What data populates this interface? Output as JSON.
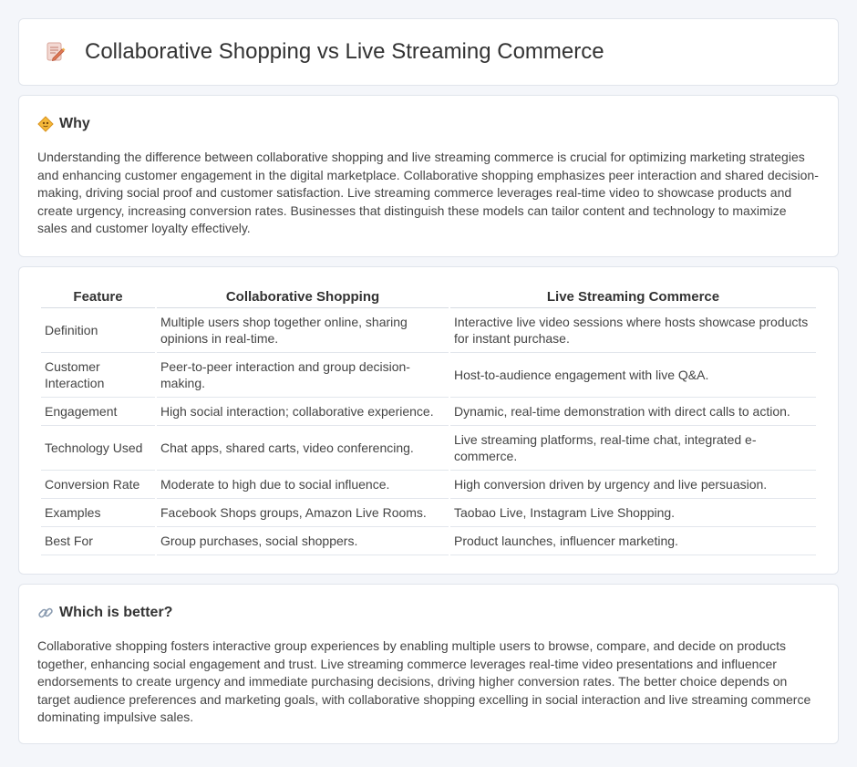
{
  "header": {
    "title": "Collaborative Shopping vs Live Streaming Commerce",
    "icon": "document-pencil-icon"
  },
  "why": {
    "title": "Why",
    "icon": "diamond-sign-icon",
    "text": "Understanding the difference between collaborative shopping and live streaming commerce is crucial for optimizing marketing strategies and enhancing customer engagement in the digital marketplace. Collaborative shopping emphasizes peer interaction and shared decision-making, driving social proof and customer satisfaction. Live streaming commerce leverages real-time video to showcase products and create urgency, increasing conversion rates. Businesses that distinguish these models can tailor content and technology to maximize sales and customer loyalty effectively."
  },
  "table": {
    "headers": [
      "Feature",
      "Collaborative Shopping",
      "Live Streaming Commerce"
    ],
    "rows": [
      [
        "Definition",
        "Multiple users shop together online, sharing opinions in real-time.",
        "Interactive live video sessions where hosts showcase products for instant purchase."
      ],
      [
        "Customer Interaction",
        "Peer-to-peer interaction and group decision-making.",
        "Host-to-audience engagement with live Q&A."
      ],
      [
        "Engagement",
        "High social interaction; collaborative experience.",
        "Dynamic, real-time demonstration with direct calls to action."
      ],
      [
        "Technology Used",
        "Chat apps, shared carts, video conferencing.",
        "Live streaming platforms, real-time chat, integrated e-commerce."
      ],
      [
        "Conversion Rate",
        "Moderate to high due to social influence.",
        "High conversion driven by urgency and live persuasion."
      ],
      [
        "Examples",
        "Facebook Shops groups, Amazon Live Rooms.",
        "Taobao Live, Instagram Live Shopping."
      ],
      [
        "Best For",
        "Group purchases, social shoppers.",
        "Product launches, influencer marketing."
      ]
    ]
  },
  "which": {
    "title": "Which is better?",
    "icon": "link-icon",
    "text": "Collaborative shopping fosters interactive group experiences by enabling multiple users to browse, compare, and decide on products together, enhancing social engagement and trust. Live streaming commerce leverages real-time video presentations and influencer endorsements to create urgency and immediate purchasing decisions, driving higher conversion rates. The better choice depends on target audience preferences and marketing goals, with collaborative shopping excelling in social interaction and live streaming commerce dominating impulsive sales."
  }
}
